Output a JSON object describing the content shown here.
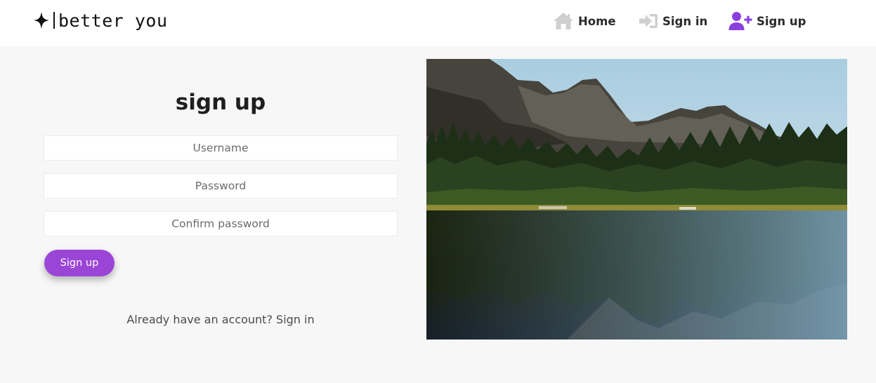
{
  "brand": {
    "name": "better you",
    "icon": "four-point-star-icon"
  },
  "nav": {
    "home": {
      "label": "Home",
      "icon": "house-icon",
      "icon_color": "#cfcfcf"
    },
    "signin": {
      "label": "Sign in",
      "icon": "sign-in-arrow-icon",
      "icon_color": "#cfcfcf"
    },
    "signup": {
      "label": "Sign up",
      "icon": "user-plus-icon",
      "icon_color": "#8a3fe0"
    }
  },
  "form": {
    "title": "sign up",
    "username_placeholder": "Username",
    "password_placeholder": "Password",
    "confirm_placeholder": "Confirm password",
    "submit_label": "Sign up",
    "signin_prompt": "Already have an account?",
    "signin_link": "Sign in"
  },
  "colors": {
    "accent": "#9b45d6",
    "page_background": "#f7f7f7",
    "navbar_background": "#ffffff"
  },
  "image": {
    "subject": "mountain-lake-reflection-photo"
  }
}
